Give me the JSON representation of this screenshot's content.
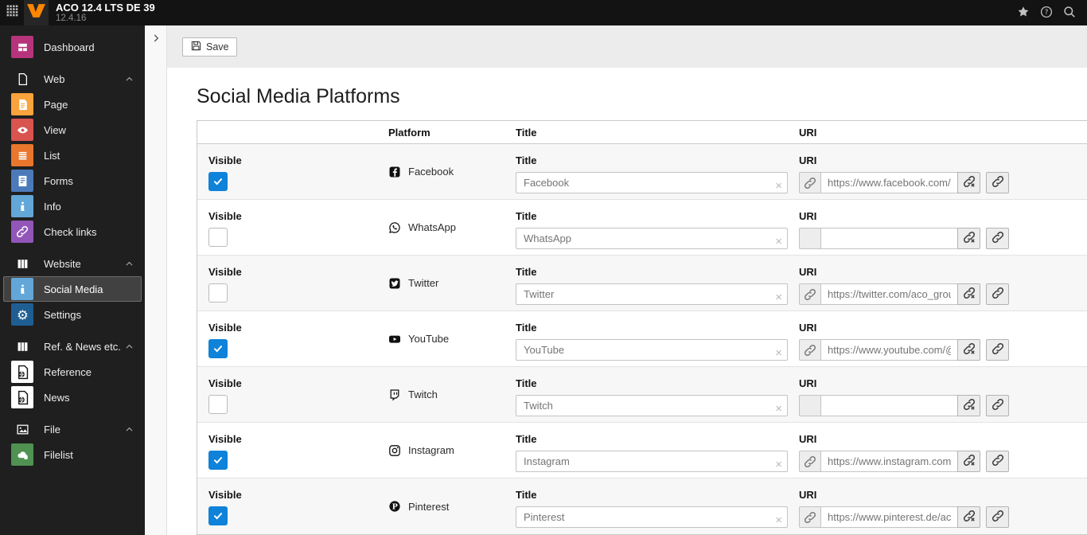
{
  "topbar": {
    "title": "ACO 12.4 LTS DE 39",
    "version": "12.4.16",
    "left_icons": [
      "modules-grid-icon",
      "typo3-logo-icon"
    ],
    "right_icons": [
      "star-icon",
      "help-icon",
      "search-icon"
    ],
    "brand_color": "#ff8700"
  },
  "sidebar": {
    "items": [
      {
        "type": "module",
        "label": "Dashboard",
        "icon": "dashboard-icon",
        "icon_bg": "#b5347c",
        "glyph": "dashboard"
      },
      {
        "type": "section",
        "label": "Web",
        "icon": "web-doc-icon",
        "glyph": "docOutline"
      },
      {
        "type": "module",
        "label": "Page",
        "icon": "page-icon",
        "icon_bg": "#f8a33c",
        "glyph": "page"
      },
      {
        "type": "module",
        "label": "View",
        "icon": "view-eye-icon",
        "icon_bg": "#d9534f",
        "glyph": "view"
      },
      {
        "type": "module",
        "label": "List",
        "icon": "list-icon",
        "icon_bg": "#e8762d",
        "glyph": "list"
      },
      {
        "type": "module",
        "label": "Forms",
        "icon": "forms-icon",
        "icon_bg": "#4a7aba",
        "glyph": "forms"
      },
      {
        "type": "module",
        "label": "Info",
        "icon": "info-icon",
        "icon_bg": "#63a6d8",
        "glyph": "info"
      },
      {
        "type": "module",
        "label": "Check links",
        "icon": "check-links-icon",
        "icon_bg": "#9256b8",
        "glyph": "chain"
      },
      {
        "type": "section",
        "label": "Website",
        "icon": "columns-icon",
        "glyph": "columns"
      },
      {
        "type": "module",
        "label": "Social Media",
        "icon": "social-media-icon",
        "icon_bg": "#63a6d8",
        "glyph": "info",
        "selected": true
      },
      {
        "type": "module",
        "label": "Settings",
        "icon": "settings-gear-icon",
        "icon_bg": "#1f5e93",
        "glyph": "gear"
      },
      {
        "type": "section",
        "label": "Ref. & News etc.",
        "icon": "columns-icon",
        "glyph": "columns"
      },
      {
        "type": "module",
        "label": "Reference",
        "icon": "reference-doc-icon",
        "icon_bg": "#ffffff",
        "glyph": "refDoc"
      },
      {
        "type": "module",
        "label": "News",
        "icon": "news-doc-icon",
        "icon_bg": "#ffffff",
        "glyph": "refDoc"
      },
      {
        "type": "section",
        "label": "File",
        "icon": "image-icon",
        "glyph": "imageOutline"
      },
      {
        "type": "module",
        "label": "Filelist",
        "icon": "filelist-icon",
        "icon_bg": "#4f9252",
        "glyph": "cloud"
      }
    ]
  },
  "docheader": {
    "save_label": "Save",
    "save_icon": "save-floppy-icon"
  },
  "main": {
    "heading": "Social Media Platforms",
    "table": {
      "headers": {
        "platform": "Platform",
        "title": "Title",
        "uri": "URI"
      },
      "visible_label": "Visible",
      "title_label": "Title",
      "uri_label": "URI",
      "rows": [
        {
          "platform": "Facebook",
          "icon": "facebook-icon",
          "visible": true,
          "title": "Facebook",
          "uri": "https://www.facebook.com/aco/"
        },
        {
          "platform": "WhatsApp",
          "icon": "whatsapp-icon",
          "visible": false,
          "title": "WhatsApp",
          "uri": ""
        },
        {
          "platform": "Twitter",
          "icon": "twitter-icon",
          "visible": false,
          "title": "Twitter",
          "uri": "https://twitter.com/aco_group"
        },
        {
          "platform": "YouTube",
          "icon": "youtube-icon",
          "visible": true,
          "title": "YouTube",
          "uri": "https://www.youtube.com/@aco"
        },
        {
          "platform": "Twitch",
          "icon": "twitch-icon",
          "visible": false,
          "title": "Twitch",
          "uri": ""
        },
        {
          "platform": "Instagram",
          "icon": "instagram-icon",
          "visible": true,
          "title": "Instagram",
          "uri": "https://www.instagram.com/aco"
        },
        {
          "platform": "Pinterest",
          "icon": "pinterest-icon",
          "visible": true,
          "title": "Pinterest",
          "uri": "https://www.pinterest.de/aco_g"
        }
      ]
    }
  },
  "colors": {
    "accent_blue": "#0f82d9",
    "topbar_bg": "#131313",
    "sidebar_bg": "#1f1f1f",
    "docheader_bg": "#ececec",
    "row_stripe": "#f7f7f7"
  }
}
